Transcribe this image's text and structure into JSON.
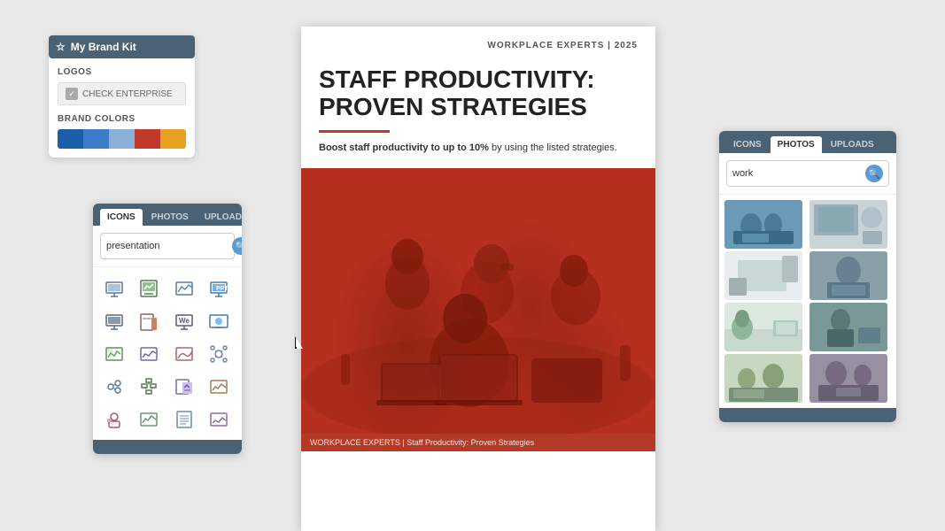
{
  "brand_kit": {
    "title": "My Brand Kit",
    "logos_label": "LOGOS",
    "check_enterprise": "CHECK ENTERPRISE",
    "brand_colors_label": "BRAND COLORS",
    "colors": [
      "#1a5fa8",
      "#3d7cc9",
      "#8ab0d8",
      "#c0392b",
      "#e8a020"
    ]
  },
  "icons_panel": {
    "tabs": [
      "ICONS",
      "PHOTOS",
      "UPLOADS"
    ],
    "active_tab": "ICONS",
    "search_placeholder": "presentation",
    "icons": [
      "📊",
      "📋",
      "📈",
      "💻",
      "📺",
      "📰",
      "📊",
      "We",
      "🖥️",
      "📊",
      "📋",
      "📈",
      "📊",
      "📈",
      "〰️",
      "🔲",
      "🔷",
      "🔲",
      "📊",
      "📈",
      "🎭",
      "📈",
      "📝",
      "📈"
    ]
  },
  "document": {
    "brand_line": "WORKPLACE EXPERTS | 2025",
    "title_line1": "STAFF PRODUCTIVITY:",
    "title_line2": "PROVEN STRATEGIES",
    "subtitle": "Boost staff productivity to up to 10% by using the listed strategies.",
    "subtitle_bold": "10%",
    "caption": "WORKPLACE EXPERTS | Staff Productivity: Proven Strategies"
  },
  "photos_panel": {
    "tabs": [
      "ICONS",
      "PHOTOS",
      "UPLOADS"
    ],
    "active_tab": "PHOTOS",
    "search_placeholder": "work",
    "search_value": "work",
    "photos_count": 8
  },
  "cursor": {
    "visible": true
  }
}
